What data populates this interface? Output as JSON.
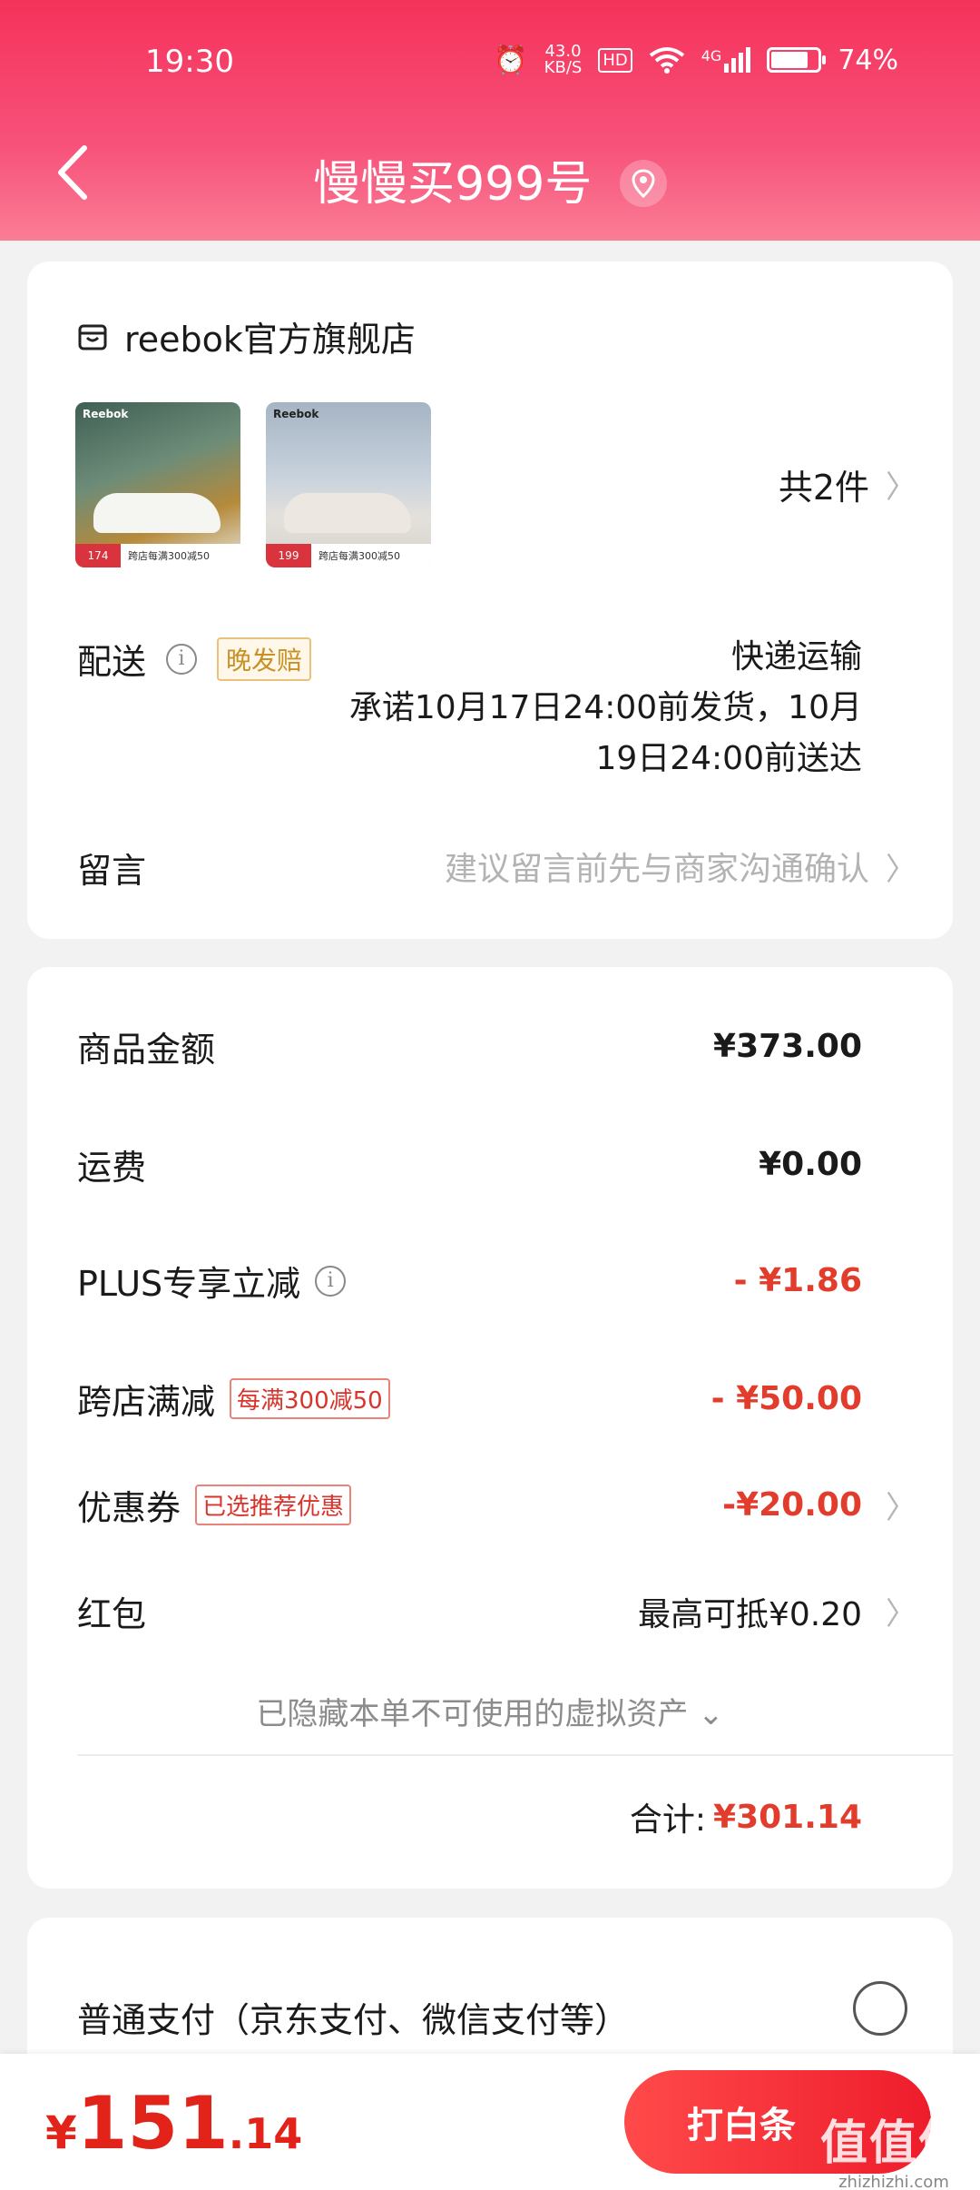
{
  "status_bar": {
    "time": "19:30",
    "net_speed_value": "43.0",
    "net_speed_unit": "KB/S",
    "hd": "HD",
    "network": "4G",
    "battery": "74%"
  },
  "nav": {
    "title": "慢慢买999号"
  },
  "order": {
    "store_name": "reebok官方旗舰店",
    "products": [
      {
        "brand": "Reebok",
        "price": "174",
        "promo": "跨店每满300减50"
      },
      {
        "brand": "Reebok",
        "price": "199",
        "promo": "跨店每满300减50"
      }
    ],
    "item_count": "共2件",
    "delivery_label": "配送",
    "delivery_badge": "晚发赔",
    "delivery_method": "快递运输",
    "delivery_promise_line1": "承诺10月17日24:00前发货，10月",
    "delivery_promise_line2": "19日24:00前送达",
    "memo_label": "留言",
    "memo_placeholder": "建议留言前先与商家沟通确认"
  },
  "summary": {
    "goods_label": "商品金额",
    "goods_value": "¥373.00",
    "shipping_label": "运费",
    "shipping_value": "¥0.00",
    "plus_label": "PLUS专享立减",
    "plus_value": "- ¥1.86",
    "cross_label": "跨店满减",
    "cross_tag": "每满300减50",
    "cross_value": "- ¥50.00",
    "coupon_label": "优惠券",
    "coupon_tag": "已选推荐优惠",
    "coupon_value": "-¥20.00",
    "redpacket_label": "红包",
    "redpacket_value": "最高可抵¥0.20",
    "hidden_assets": "已隐藏本单不可使用的虚拟资产",
    "total_label": "合计:",
    "total_value": "¥301.14"
  },
  "payment": {
    "normal_label": "普通支付（京东支付、微信支付等）"
  },
  "bottom": {
    "price_symbol": "¥",
    "price_int": "151",
    "price_dec": ".14",
    "button_label": "打白条"
  },
  "watermark": {
    "main": "值值值",
    "sub": "zhizhizhi.com"
  },
  "colors": {
    "header_start": "#f5325a",
    "accent_red": "#e23c2c",
    "badge_gold": "#c99023"
  }
}
